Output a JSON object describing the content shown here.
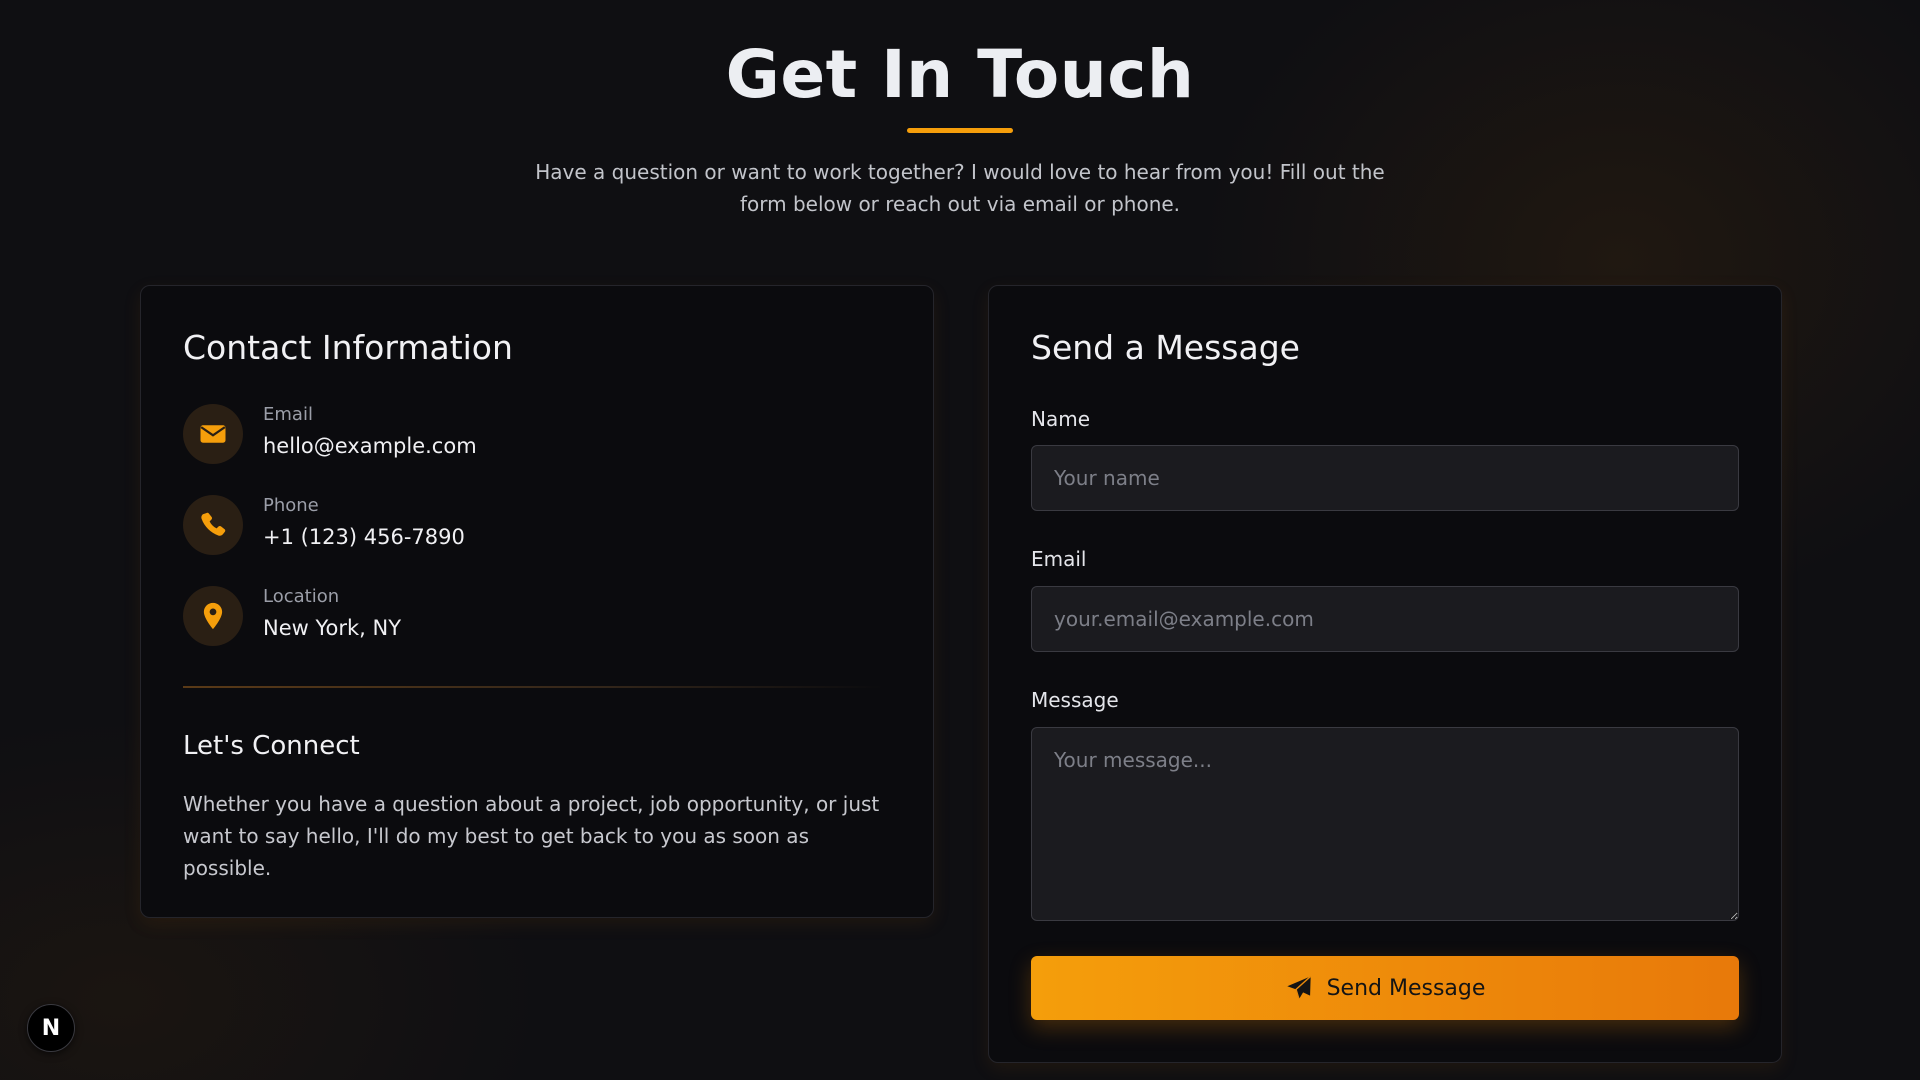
{
  "header": {
    "title": "Get In Touch",
    "subtitle": "Have a question or want to work together? I would love to hear from you! Fill out the form below or reach out via email or phone."
  },
  "contact_info": {
    "title": "Contact Information",
    "items": [
      {
        "label": "Email",
        "value": "hello@example.com",
        "icon": "envelope-icon"
      },
      {
        "label": "Phone",
        "value": "+1 (123) 456-7890",
        "icon": "phone-icon"
      },
      {
        "label": "Location",
        "value": "New York, NY",
        "icon": "map-pin-icon"
      }
    ],
    "connect_title": "Let's Connect",
    "connect_text": "Whether you have a question about a project, job opportunity, or just want to say hello, I'll do my best to get back to you as soon as possible."
  },
  "message_form": {
    "title": "Send a Message",
    "name_label": "Name",
    "name_placeholder": "Your name",
    "email_label": "Email",
    "email_placeholder": "your.email@example.com",
    "message_label": "Message",
    "message_placeholder": "Your message...",
    "submit_label": "Send Message",
    "submit_icon": "paper-plane-icon"
  },
  "dev_badge": {
    "letter": "N",
    "icon": "nextjs-logo-icon"
  },
  "colors": {
    "accent": "#f59e0b",
    "background": "#0f0f12",
    "card": "#0b0b0e",
    "icon_bg": "#2a1f14"
  }
}
